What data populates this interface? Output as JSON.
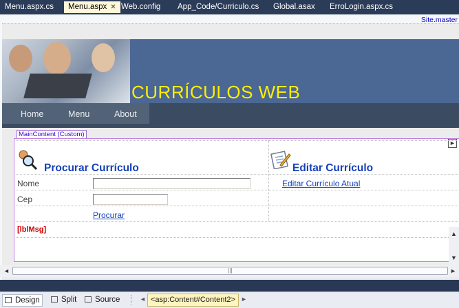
{
  "tabs": [
    {
      "label": "Menu.aspx.cs"
    },
    {
      "label": "Menu.aspx",
      "close": "✕"
    },
    {
      "label": "Web.config"
    },
    {
      "label": "App_Code/Curriculo.cs"
    },
    {
      "label": "Global.asax"
    },
    {
      "label": "ErroLogin.aspx.cs"
    }
  ],
  "master_label": "Site.master",
  "site": {
    "title": "CURRÍCULOS WEB",
    "nav": [
      "Home",
      "Menu",
      "About"
    ]
  },
  "content": {
    "placeholder_label": "MainContent (Custom)",
    "search": {
      "heading": "Procurar Currículo",
      "name_label": "Nome",
      "cep_label": "Cep",
      "name_value": "",
      "cep_value": "",
      "submit_label": "Procurar",
      "message": "[lblMsg]"
    },
    "edit": {
      "heading": "Editar Currículo",
      "link": "Editar Currículo Atual"
    }
  },
  "scroll": {
    "left": "◄",
    "right": "►",
    "up": "▲",
    "down": "▼",
    "grip": "|||"
  },
  "bottom": {
    "views": [
      {
        "label": "Design",
        "active": true
      },
      {
        "label": "Split",
        "active": false
      },
      {
        "label": "Source",
        "active": false
      }
    ],
    "breadcrumb": "<asp:Content#Content2>",
    "prev": "◄",
    "next": "►"
  },
  "colors": {
    "tabstrip": "#2b3c59",
    "banner": "#4b6794",
    "title": "#ffee00",
    "heading": "#1540b8",
    "message": "#cc0000"
  },
  "icons": {
    "search_section": "magnifier-person-icon",
    "edit_section": "edit-document-icon"
  }
}
